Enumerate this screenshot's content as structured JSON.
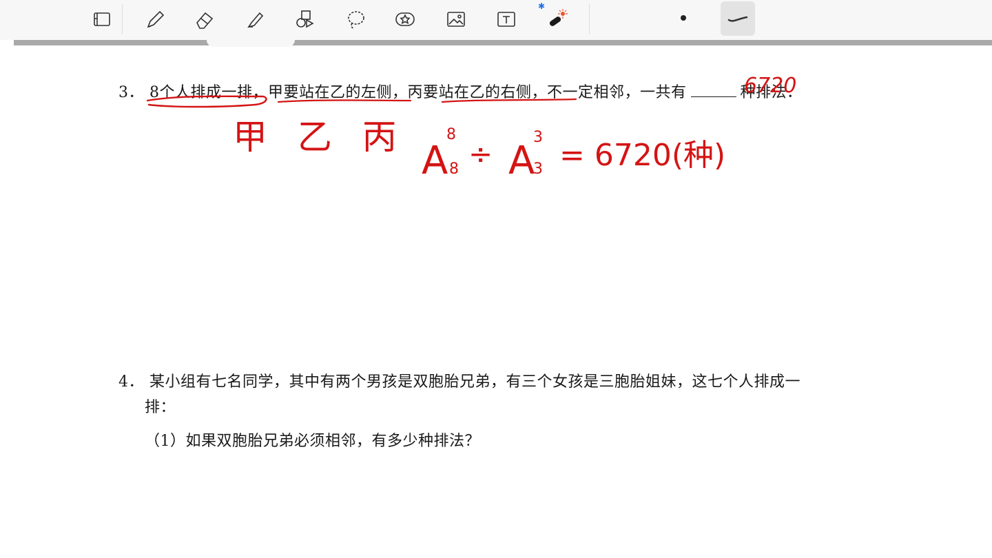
{
  "toolbar": {
    "tools": [
      {
        "name": "page-view-icon"
      },
      {
        "name": "pen-icon"
      },
      {
        "name": "eraser-icon"
      },
      {
        "name": "highlighter-icon"
      },
      {
        "name": "shapes-icon"
      },
      {
        "name": "lasso-icon"
      },
      {
        "name": "sticker-icon"
      },
      {
        "name": "image-icon"
      },
      {
        "name": "text-icon"
      },
      {
        "name": "laser-pointer-icon"
      }
    ],
    "bluetooth_symbol": "✱"
  },
  "questions": {
    "q3": {
      "number": "3．",
      "text_before_blank": "8个人排成一排，甲要站在乙的左侧，丙要站在乙的右侧，不一定相邻，一共有",
      "text_after_blank": "种排法．"
    },
    "q4": {
      "number": "4．",
      "line1": "某小组有七名同学，其中有两个男孩是双胞胎兄弟，有三个女孩是三胞胎姐妹，这七个人排成一",
      "line2": "排：",
      "sub1": "（1）如果双胞胎兄弟必须相邻，有多少种排法？"
    }
  },
  "handwriting": {
    "blank_answer": "6720",
    "names": "甲 乙 丙",
    "formula_a": "A",
    "formula_sup1": "8",
    "formula_sub1": "8",
    "formula_div": "÷",
    "formula_sup2": "3",
    "formula_sub2": "3",
    "formula_result": "= 6720(种)"
  },
  "colors": {
    "ink": "#d41414",
    "toolbar_bg": "#f7f7f7",
    "text": "#1a1a1a"
  }
}
